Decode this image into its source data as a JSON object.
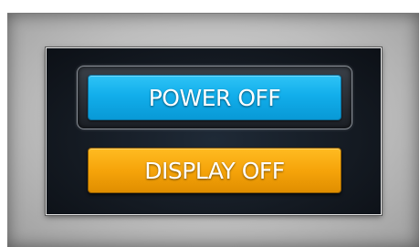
{
  "buttons": {
    "power_off": "POWER OFF",
    "display_off": "DISPLAY OFF"
  },
  "colors": {
    "power_button": "#12aeeb",
    "display_button": "#f6a40a",
    "panel_background": "#141a22"
  }
}
